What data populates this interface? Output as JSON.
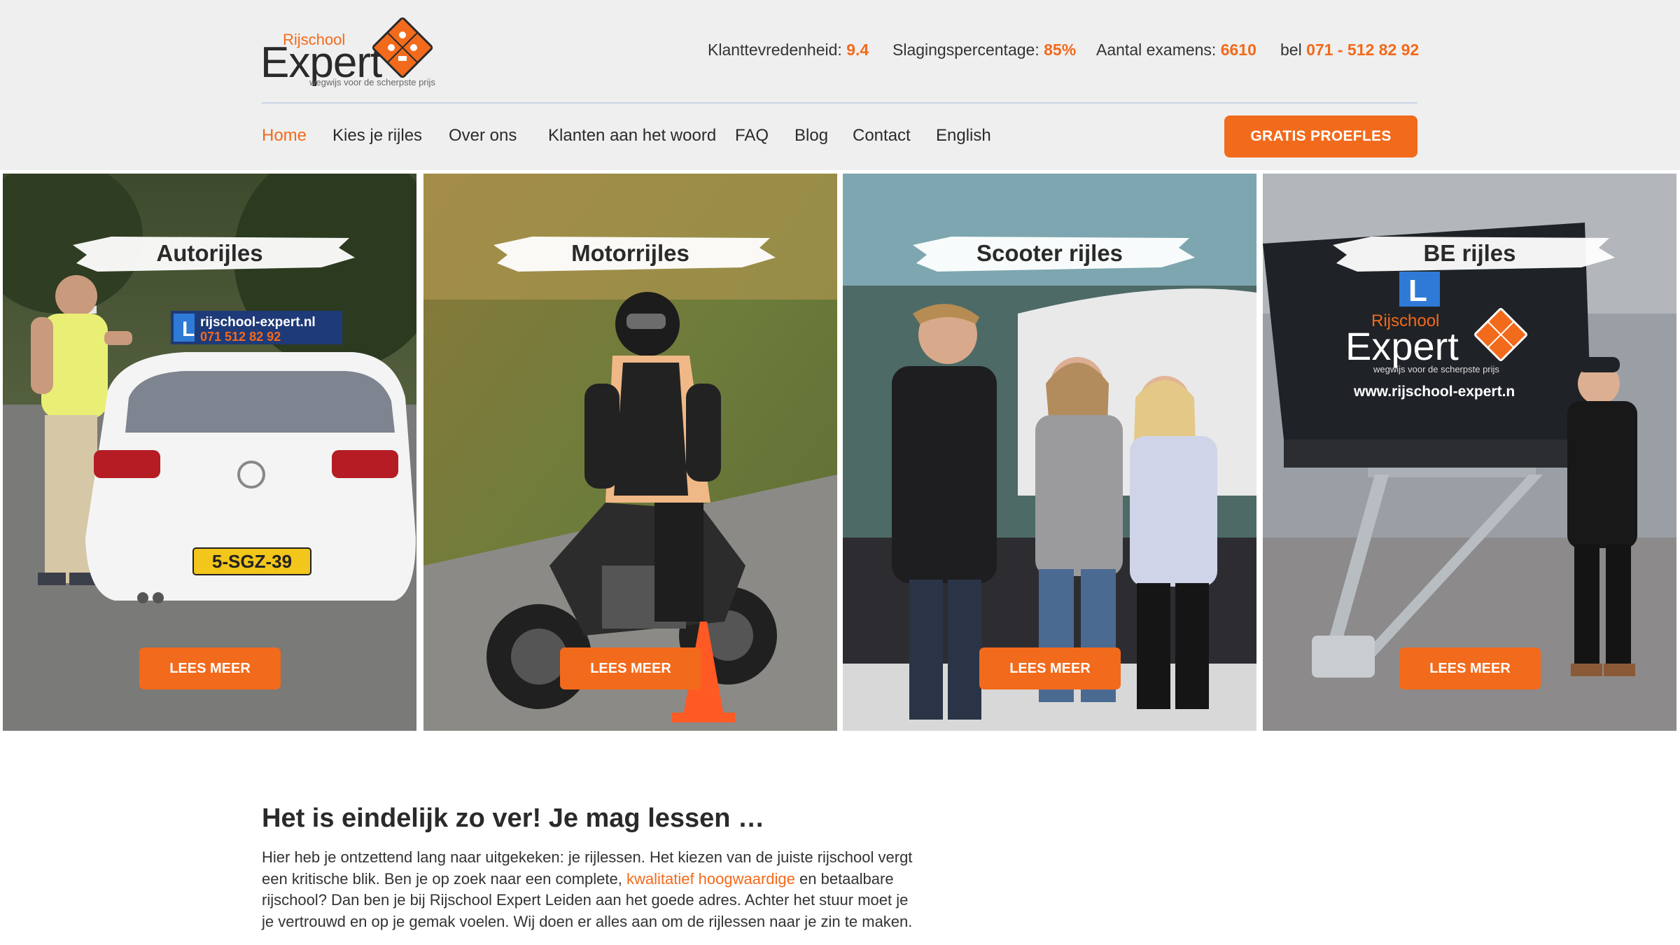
{
  "brand": {
    "name_small": "Rijschool",
    "name_large": "Expert",
    "tagline": "wegwijs voor de scherpste prijs"
  },
  "stats": [
    {
      "label": "Klanttevredenheid:",
      "value": "9.4"
    },
    {
      "label": "Slagingspercentage:",
      "value": "85%"
    },
    {
      "label": "Aantal examens:",
      "value": "6610"
    },
    {
      "label": "bel",
      "value": "071 - 512 82 92"
    }
  ],
  "nav": [
    {
      "label": "Home",
      "active": true
    },
    {
      "label": "Kies je rijles"
    },
    {
      "label": "Over ons"
    },
    {
      "label": "Klanten aan het woord"
    },
    {
      "label": "FAQ"
    },
    {
      "label": "Blog"
    },
    {
      "label": "Contact"
    },
    {
      "label": "English"
    }
  ],
  "cta_label": "GRATIS PROEFLES",
  "panels": [
    {
      "title": "Autorijles",
      "button": "LEES MEER",
      "sign_text": "rijschool-expert.nl",
      "sign_phone": "071 512 82 92",
      "plate": "5-SGZ-39"
    },
    {
      "title": "Motorrijles",
      "button": "LEES MEER"
    },
    {
      "title": "Scooter rijles",
      "button": "LEES MEER"
    },
    {
      "title": "BE rijles",
      "button": "LEES MEER",
      "trailer_small": "Rijschool",
      "trailer_large": "Expert",
      "trailer_tag": "wegwijs voor de scherpste prijs",
      "trailer_url": "www.rijschool-expert.n"
    }
  ],
  "content": {
    "heading": "Het is eindelijk zo ver! Je mag lessen …",
    "para_before": "Hier heb je ontzettend lang naar uitgekeken: je rijlessen. Het kiezen van de juiste rijschool vergt een kritische blik. Ben je op zoek naar een complete, ",
    "para_link": "kwalitatief hoogwaardige",
    "para_after": " en betaalbare rijschool? Dan ben je bij Rijschool Expert Leiden aan het goede adres. Achter het stuur moet je je vertrouwd en op je gemak voelen. Wij doen er alles aan om de rijlessen naar je zin te maken."
  },
  "colors": {
    "accent": "#f26a1b",
    "header_bg": "#efefef",
    "text": "#2a2a2a"
  }
}
